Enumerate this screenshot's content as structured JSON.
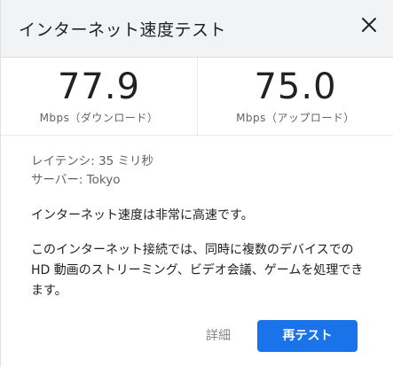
{
  "header": {
    "title": "インターネット速度テスト"
  },
  "results": {
    "download": {
      "value": "77.9",
      "unit": "Mbps（ダウンロード）"
    },
    "upload": {
      "value": "75.0",
      "unit": "Mbps（アップロード）"
    }
  },
  "info": {
    "latency": "レイテンシ: 35 ミリ秒",
    "server": "サーバー: Tokyo"
  },
  "description": {
    "speed_summary": "インターネット速度は非常に高速です。",
    "capability": "このインターネット接続では、同時に複数のデバイスでの HD 動画のストリーミング、ビデオ会議、ゲームを処理できます。"
  },
  "actions": {
    "details_label": "詳細",
    "retest_label": "再テスト"
  },
  "colors": {
    "accent": "#1a73e8",
    "header_bg": "#f1f3f4"
  }
}
